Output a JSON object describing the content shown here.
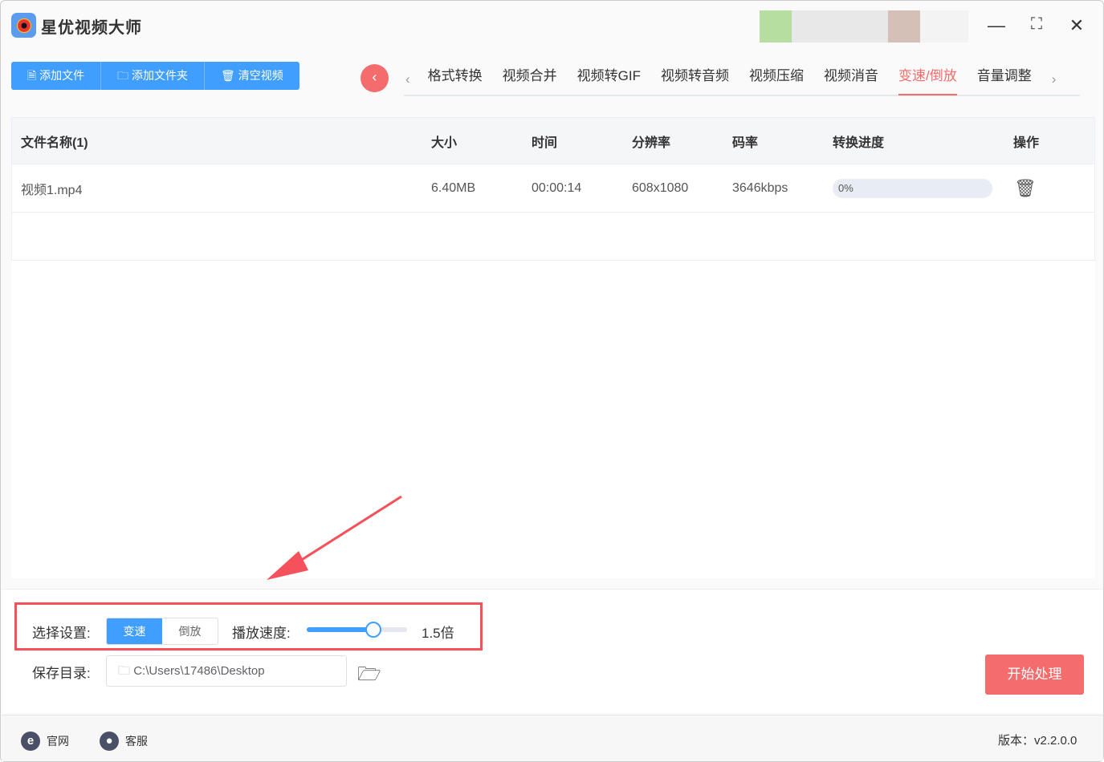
{
  "app": {
    "title": "星优视频大师"
  },
  "toolbar": {
    "add_file": "添加文件",
    "add_folder": "添加文件夹",
    "clear": "清空视频"
  },
  "tabs": [
    {
      "label": "格式转换"
    },
    {
      "label": "视频合并"
    },
    {
      "label": "视频转GIF"
    },
    {
      "label": "视频转音频"
    },
    {
      "label": "视频压缩"
    },
    {
      "label": "视频消音"
    },
    {
      "label": "变速/倒放",
      "active": true
    },
    {
      "label": "音量调整"
    }
  ],
  "table": {
    "headers": [
      "文件名称(1)",
      "大小",
      "时间",
      "分辨率",
      "码率",
      "转换进度",
      "操作"
    ],
    "rows": [
      {
        "name": "视频1.mp4",
        "size": "6.40MB",
        "time": "00:00:14",
        "resolution": "608x1080",
        "bitrate": "3646kbps",
        "progress": "0%"
      }
    ]
  },
  "settings": {
    "select_label": "选择设置:",
    "speed_tab": "变速",
    "reverse_tab": "倒放",
    "speed_label": "播放速度:",
    "speed_value": "1.5倍",
    "slider_fraction": 0.66,
    "save_label": "保存目录:",
    "save_path": "C:\\Users\\17486\\Desktop",
    "start": "开始处理"
  },
  "footer": {
    "website": "官网",
    "support": "客服",
    "version": "版本：v2.2.0.0"
  },
  "colors": {
    "primary": "#409eff",
    "accent": "#f56c6c"
  }
}
